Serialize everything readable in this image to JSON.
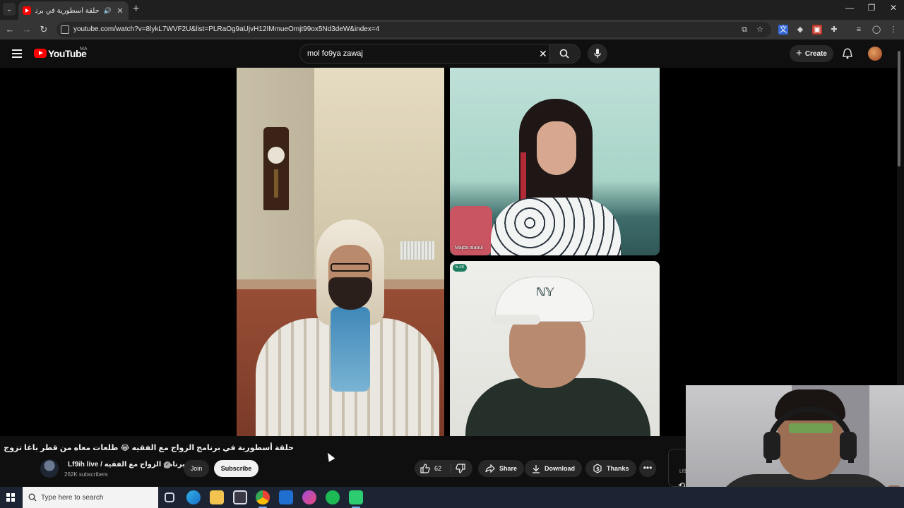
{
  "browser": {
    "tab": {
      "title": "حلقة أسطورية في برنامج الزواج مع الفقيه",
      "audio_icon": "speaker-icon"
    },
    "address": {
      "url": "youtube.com/watch?v=8lykL7WVF2U&list=PLRaOg9aUjvH12IMmueOmjt99ox5Nd3deW&index=4"
    }
  },
  "youtube": {
    "brand": "YouTube",
    "country_code": "MA",
    "search": {
      "query": "mol fo9ya zawaj"
    },
    "create_label": "Create"
  },
  "video": {
    "participant_label": "Majda alaoui",
    "viewer_badge": "5.1K",
    "title": "حلقة أسطورية في برنامج الزواج مع الفقيه 😂 طلعات معاه من قطر باغا تزوج",
    "channel": {
      "name": "Lf9ih live / برنامج الزواج مع الفقيه",
      "subscribers": "262K subscribers"
    },
    "join_label": "Join",
    "subscribe_label": "Subscribe",
    "like_count": "62",
    "share_label": "Share",
    "download_label": "Download",
    "thanks_label": "Thanks",
    "more_label": "•••",
    "side_panel_text": "Lf9"
  },
  "taskbar": {
    "search_placeholder": "Type here to search"
  },
  "colors": {
    "youtube_red": "#ff0000",
    "page_bg": "#0f0f0f",
    "chip_bg": "#272727",
    "taskbar_bg": "#1c2433"
  }
}
